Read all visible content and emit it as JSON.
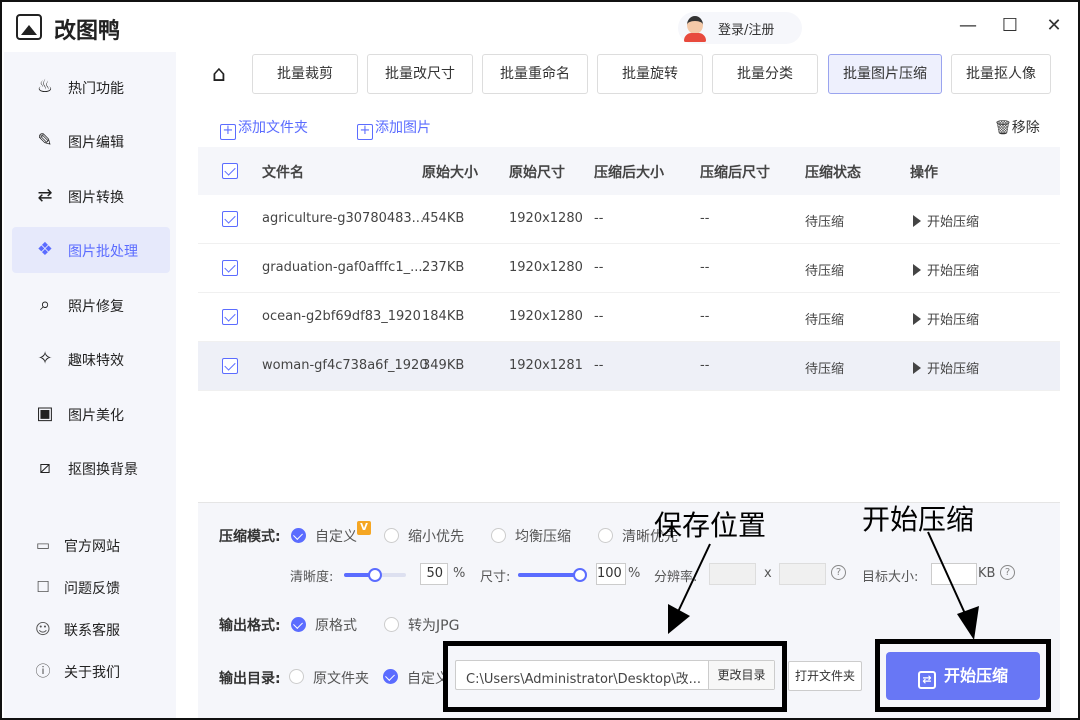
{
  "app": {
    "title": "改图鸭",
    "login_label": "登录/注册"
  },
  "window": {
    "minimize": "—",
    "maximize": "☐",
    "close": "✕"
  },
  "sidebar": {
    "items": [
      {
        "label": "热门功能",
        "icon": "fire-icon"
      },
      {
        "label": "图片编辑",
        "icon": "image-edit-icon"
      },
      {
        "label": "图片转换",
        "icon": "convert-icon"
      },
      {
        "label": "图片批处理",
        "icon": "batch-icon"
      },
      {
        "label": "照片修复",
        "icon": "photo-repair-icon"
      },
      {
        "label": "趣味特效",
        "icon": "magic-wand-icon"
      },
      {
        "label": "图片美化",
        "icon": "image-beautify-icon"
      },
      {
        "label": "抠图换背景",
        "icon": "cutout-icon"
      }
    ],
    "active_index": 3,
    "footer": [
      {
        "label": "官方网站",
        "icon": "monitor-icon"
      },
      {
        "label": "问题反馈",
        "icon": "feedback-icon"
      },
      {
        "label": "联系客服",
        "icon": "service-icon"
      },
      {
        "label": "关于我们",
        "icon": "info-icon"
      }
    ]
  },
  "tabs": [
    "批量裁剪",
    "批量改尺寸",
    "批量重命名",
    "批量旋转",
    "批量分类",
    "批量图片压缩",
    "批量抠人像"
  ],
  "active_tab": 5,
  "toolbar": {
    "add_folder": "添加文件夹",
    "add_image": "添加图片",
    "remove": "移除"
  },
  "table": {
    "headers": [
      "文件名",
      "原始大小",
      "原始尺寸",
      "压缩后大小",
      "压缩后尺寸",
      "压缩状态",
      "操作"
    ],
    "rows": [
      {
        "name": "agriculture-g30780483...",
        "size": "454KB",
        "dims": "1920x1280",
        "csize": "--",
        "cdims": "--",
        "status": "待压缩",
        "action": "开始压缩"
      },
      {
        "name": "graduation-gaf0afffc1_...",
        "size": "237KB",
        "dims": "1920x1280",
        "csize": "--",
        "cdims": "--",
        "status": "待压缩",
        "action": "开始压缩"
      },
      {
        "name": "ocean-g2bf69df83_1920",
        "size": "184KB",
        "dims": "1920x1280",
        "csize": "--",
        "cdims": "--",
        "status": "待压缩",
        "action": "开始压缩"
      },
      {
        "name": "woman-gf4c738a6f_1920",
        "size": "349KB",
        "dims": "1920x1281",
        "csize": "--",
        "cdims": "--",
        "status": "待压缩",
        "action": "开始压缩"
      }
    ]
  },
  "settings": {
    "mode_label": "压缩模式:",
    "modes": [
      "自定义",
      "缩小优先",
      "均衡压缩",
      "清晰优先"
    ],
    "mode_selected": 0,
    "vip_badge": "V",
    "clarity_label": "清晰度:",
    "clarity_value": "50",
    "clarity_percent": 50,
    "size_label": "尺寸:",
    "size_value": "100",
    "size_percent": 100,
    "percent_sign": "%",
    "resolution_label": "分辨率:",
    "x_sep": "x",
    "target_label": "目标大小:",
    "target_unit": "KB",
    "help": "?",
    "format_label": "输出格式:",
    "formats": [
      "原格式",
      "转为JPG"
    ],
    "format_selected": 0,
    "dir_label": "输出目录:",
    "dirs": [
      "原文件夹",
      "自定义"
    ],
    "dir_selected": 1,
    "path": "C:\\Users\\Administrator\\Desktop\\改...",
    "change_dir": "更改目录",
    "open_folder": "打开文件夹",
    "start": "开始压缩"
  },
  "annotations": {
    "save_location": "保存位置",
    "start_compress": "开始压缩"
  },
  "colors": {
    "accent": "#5b6cff",
    "start_button": "#6877f5"
  }
}
